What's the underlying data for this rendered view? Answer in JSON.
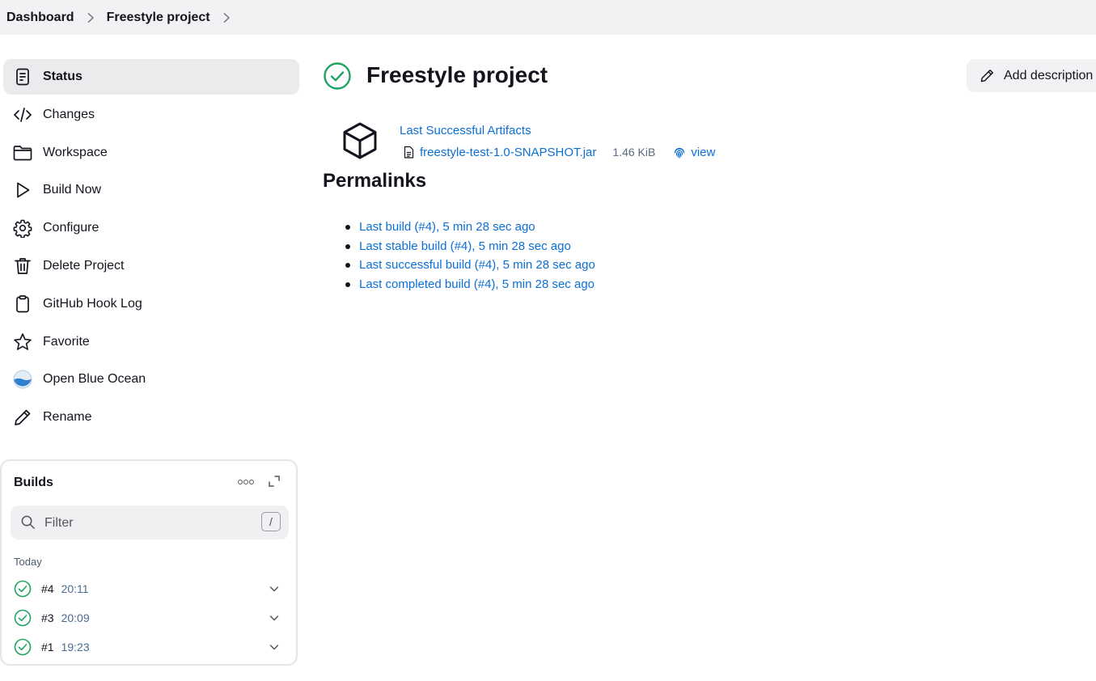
{
  "breadcrumb": {
    "items": [
      {
        "label": "Dashboard"
      },
      {
        "label": "Freestyle project"
      }
    ]
  },
  "sidebar": {
    "items": [
      {
        "label": "Status",
        "icon": "document-icon",
        "active": true
      },
      {
        "label": "Changes",
        "icon": "code-icon"
      },
      {
        "label": "Workspace",
        "icon": "folder-icon"
      },
      {
        "label": "Build Now",
        "icon": "play-icon"
      },
      {
        "label": "Configure",
        "icon": "gear-icon"
      },
      {
        "label": "Delete Project",
        "icon": "trash-icon"
      },
      {
        "label": "GitHub Hook Log",
        "icon": "clipboard-icon"
      },
      {
        "label": "Favorite",
        "icon": "star-icon"
      },
      {
        "label": "Open Blue Ocean",
        "icon": "blue-ocean-icon"
      },
      {
        "label": "Rename",
        "icon": "pencil-icon"
      }
    ]
  },
  "builds": {
    "title": "Builds",
    "filter_placeholder": "Filter",
    "filter_shortcut": "/",
    "group_label": "Today",
    "rows": [
      {
        "number": "#4",
        "time": "20:11",
        "status": "success"
      },
      {
        "number": "#3",
        "time": "20:09",
        "status": "success"
      },
      {
        "number": "#1",
        "time": "19:23",
        "status": "success"
      }
    ]
  },
  "main": {
    "title": "Freestyle project",
    "status": "success",
    "add_description_label": "Add description",
    "artifacts": {
      "link_label": "Last Successful Artifacts",
      "file_name": "freestyle-test-1.0-SNAPSHOT.jar",
      "file_size": "1.46 KiB",
      "view_label": "view"
    },
    "permalinks_title": "Permalinks",
    "permalinks": [
      "Last build (#4), 5 min 28 sec ago",
      "Last stable build (#4), 5 min 28 sec ago",
      "Last successful build (#4), 5 min 28 sec ago",
      "Last completed build (#4), 5 min 28 sec ago"
    ]
  },
  "colors": {
    "link": "#0b6fd6",
    "success": "#1ea362",
    "breadcrumb_bg": "#f2f2f5",
    "active_item_bg": "#ebebee"
  }
}
